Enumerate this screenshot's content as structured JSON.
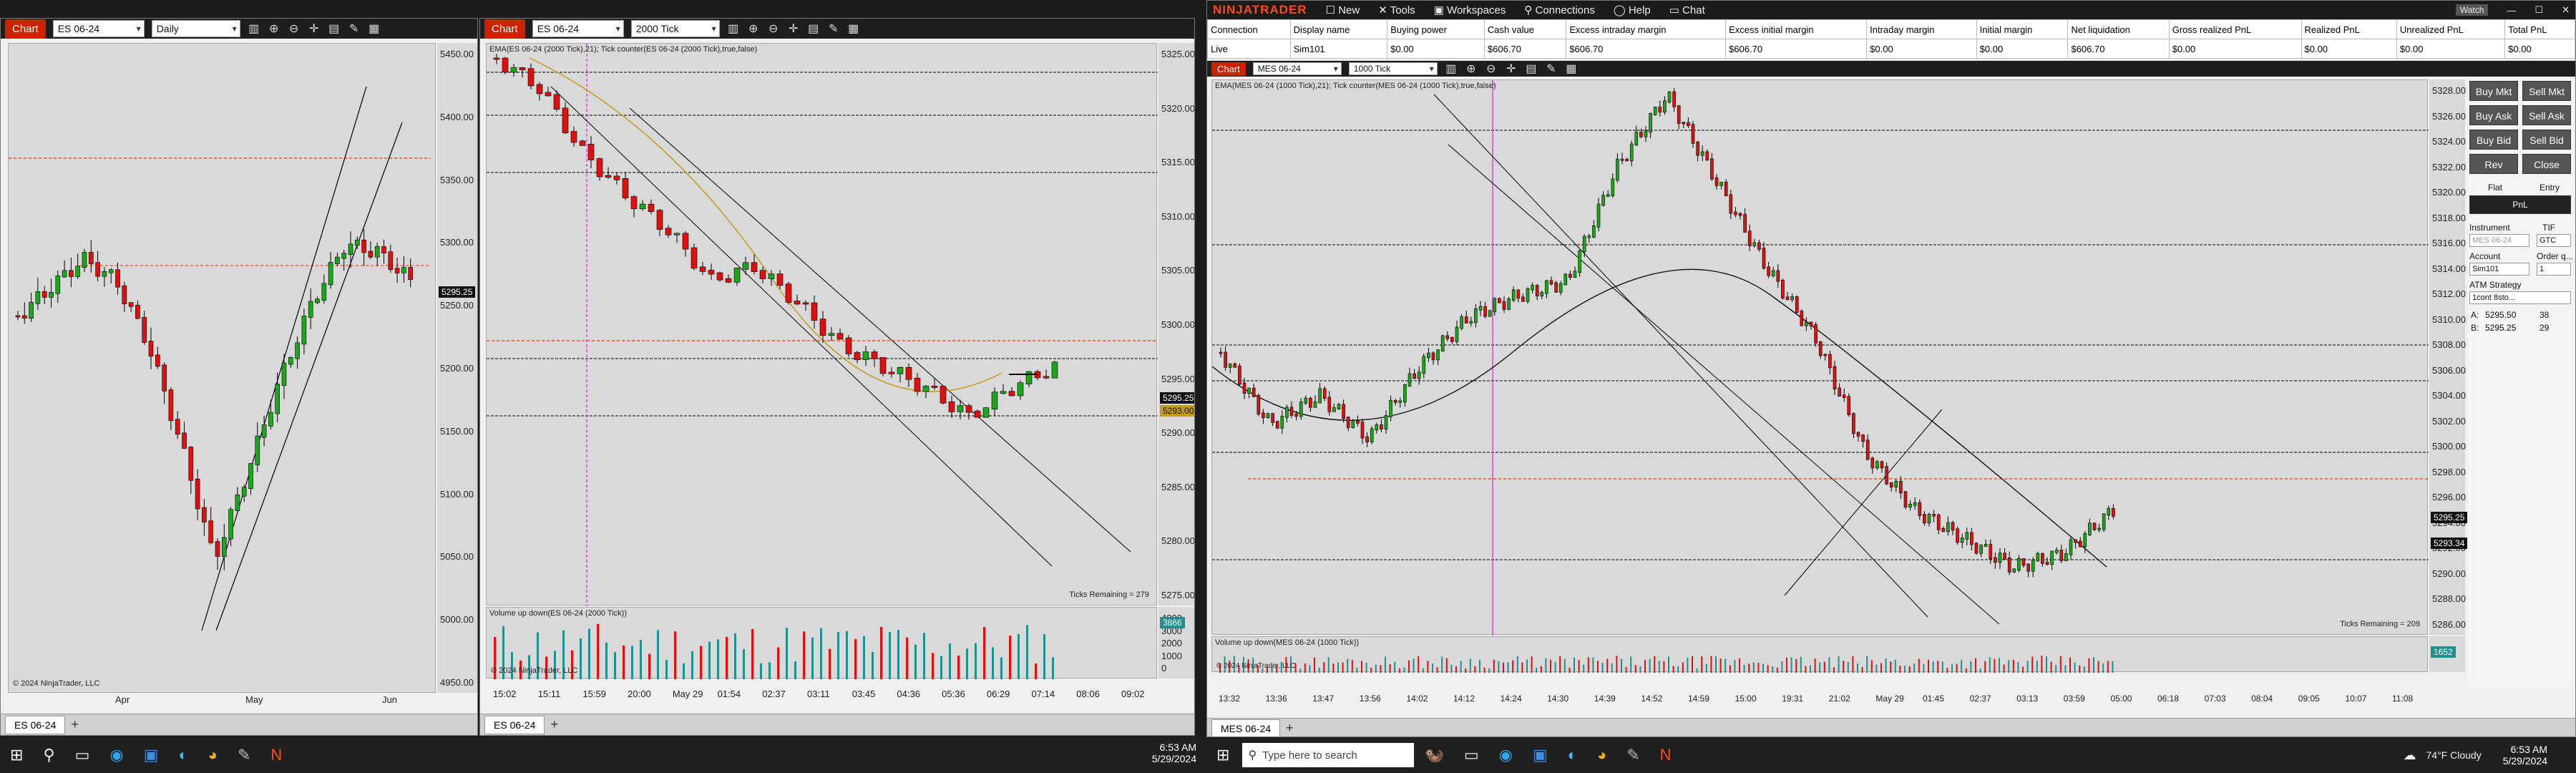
{
  "left_window": {
    "chart_tab": "Chart",
    "instrument": "ES 06-24",
    "interval": "Daily",
    "price_labels": [
      "5450.00",
      "5400.00",
      "5350.00",
      "5300.00",
      "5250.00",
      "5200.00",
      "5150.00",
      "5100.00",
      "5050.00",
      "5000.00",
      "4950.00"
    ],
    "current_price": "5295.25",
    "x_labels": [
      "Apr",
      "May",
      "Jun"
    ],
    "copyright": "© 2024 NinjaTrader, LLC",
    "bottom_tab": "ES 06-24"
  },
  "middle_window": {
    "chart_tab": "Chart",
    "instrument": "ES 06-24",
    "interval": "2000 Tick",
    "indicator_label": "EMA(ES 06-24 (2000 Tick),21); Tick counter(ES 06-24 (2000 Tick),true,false)",
    "price_labels": [
      "5325.00",
      "5320.00",
      "5315.00",
      "5310.00",
      "5305.00",
      "5300.00",
      "5295.00",
      "5290.00",
      "5285.00",
      "5280.00",
      "5275.00"
    ],
    "current_price": "5295.25",
    "secondary_price": "5293.00",
    "ticks_remaining": "Ticks Remaining = 279",
    "volume_label": "Volume up down(ES 06-24 (2000 Tick))",
    "volume_axis": [
      "4000",
      "3000",
      "2000",
      "1000",
      "0"
    ],
    "volume_value": "3866",
    "x_labels": [
      "15:02",
      "15:11",
      "15:59",
      "20:00",
      "May 29",
      "01:54",
      "02:37",
      "03:11",
      "03:45",
      "04:36",
      "05:36",
      "06:29",
      "07:14",
      "08:06",
      "09:02"
    ],
    "copyright": "© 2024 NinjaTrader, LLC",
    "bottom_tab": "ES 06-24"
  },
  "right_window": {
    "brand": "NINJATRADER",
    "menu": [
      "New",
      "Tools",
      "Workspaces",
      "Connections",
      "Help",
      "Chat"
    ],
    "grid_headers": [
      "Connection",
      "Display name",
      "Buying power",
      "Cash value",
      "Excess intraday margin",
      "Excess initial margin",
      "Intraday margin",
      "Initial margin",
      "Net liquidation",
      "Gross realized PnL",
      "Realized PnL",
      "Unrealized PnL",
      "Total PnL"
    ],
    "grid_row": [
      "Live",
      "Sim101",
      "$0.00",
      "$606.70",
      "$606.70",
      "$606.70",
      "$0.00",
      "$0.00",
      "$606.70",
      "$0.00",
      "$0.00",
      "$0.00",
      "$0.00"
    ],
    "chart_tab": "Chart",
    "instrument": "MES 06-24",
    "interval": "1000 Tick",
    "indicator_label": "EMA(MES 06-24 (1000 Tick),21); Tick counter(MES 06-24 (1000 Tick),true,false)",
    "price_labels": [
      "5328.00",
      "5326.00",
      "5324.00",
      "5322.00",
      "5320.00",
      "5318.00",
      "5316.00",
      "5314.00",
      "5312.00",
      "5310.00",
      "5308.00",
      "5306.00",
      "5304.00",
      "5302.00",
      "5300.00",
      "5298.00",
      "5296.00",
      "5294.00",
      "5292.00",
      "5290.00",
      "5288.00",
      "5286.00"
    ],
    "current_price": "5295.25",
    "secondary_price": "5293.34",
    "ticks_remaining": "Ticks Remaining = 209",
    "volume_label": "Volume up down(MES 06-24 (1000 Tick))",
    "volume_value": "1652",
    "x_labels": [
      "13:32",
      "13:36",
      "13:47",
      "13:56",
      "14:02",
      "14:12",
      "14:24",
      "14:30",
      "14:39",
      "14:52",
      "14:59",
      "15:00",
      "19:31",
      "21:02",
      "May 29",
      "01:45",
      "02:37",
      "03:13",
      "03:59",
      "05:00",
      "06:18",
      "07:03",
      "08:04",
      "09:05",
      "10:07",
      "11:08"
    ],
    "copyright": "© 2024 NinjaTrader, LLC",
    "bottom_tab": "MES 06-24",
    "side_buttons": [
      "Buy Mkt",
      "Sell Mkt",
      "Buy Ask",
      "Sell Ask",
      "Buy Bid",
      "Sell Bid",
      "Rev",
      "Close"
    ],
    "flat": "Flat",
    "entry": "Entry",
    "pnl": "PnL",
    "instrument_label": "Instrument",
    "tif_label": "TIF",
    "instrument_value": "MES 06-24",
    "tif_value": "GTC",
    "account_label": "Account",
    "order_qty_label": "Order q...",
    "account_value": "Sim101",
    "qty_value": "1",
    "atm_label": "ATM Strategy",
    "atm_value": "1cont 8sto...",
    "ask_label": "A:",
    "ask_price": "5295.50",
    "ask_size": "38",
    "bid_label": "B:",
    "bid_price": "5295.25",
    "bid_size": "29",
    "window_btns": [
      "Watch"
    ]
  },
  "taskbar_left": {
    "time": "6:53 AM",
    "date": "5/29/2024"
  },
  "taskbar_right": {
    "search_placeholder": "Type here to search",
    "weather": "74°F  Cloudy",
    "time": "6:53 AM",
    "date": "5/29/2024"
  }
}
